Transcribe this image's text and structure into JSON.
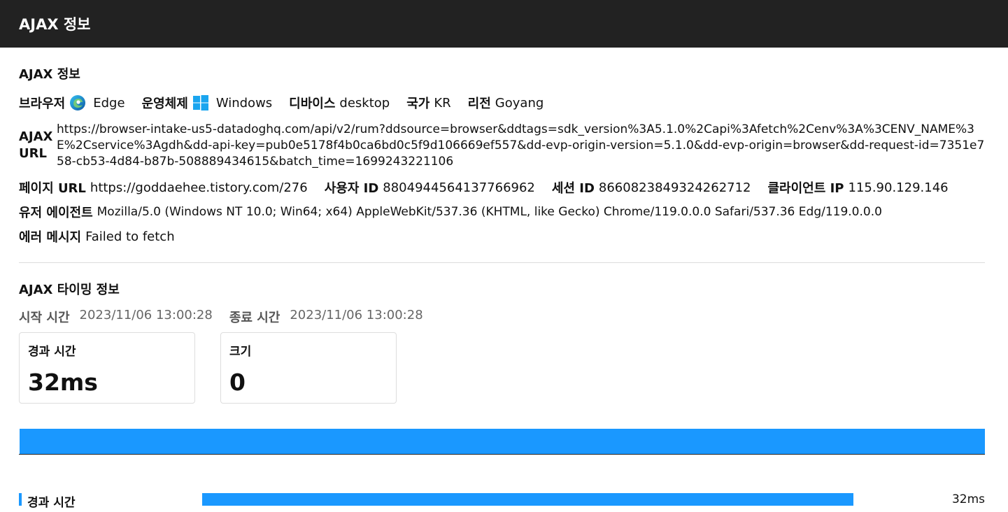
{
  "header": {
    "title": "AJAX 정보"
  },
  "info": {
    "title": "AJAX 정보",
    "browser_label": "브라우저",
    "browser_value": "Edge",
    "os_label": "운영체제",
    "os_value": "Windows",
    "device_label": "디바이스",
    "device_value": "desktop",
    "country_label": "국가",
    "country_value": "KR",
    "region_label": "리전",
    "region_value": "Goyang",
    "url_label": "AJAX URL",
    "url_value": "https://browser-intake-us5-datadoghq.com/api/v2/rum?ddsource=browser&ddtags=sdk_version%3A5.1.0%2Capi%3Afetch%2Cenv%3A%3CENV_NAME%3E%2Cservice%3Agdh&dd-api-key=pub0e5178f4b0ca6bd0c5f9d106669ef557&dd-evp-origin-version=5.1.0&dd-evp-origin=browser&dd-request-id=7351e758-cb53-4d84-b87b-508889434615&batch_time=1699243221106",
    "page_url_label": "페이지 URL",
    "page_url_value": "https://goddaehee.tistory.com/276",
    "user_id_label": "사용자 ID",
    "user_id_value": "8804944564137766962",
    "session_id_label": "세션 ID",
    "session_id_value": "8660823849324262712",
    "client_ip_label": "클라이언트 IP",
    "client_ip_value": "115.90.129.146",
    "user_agent_label": "유저 에이전트",
    "user_agent_value": "Mozilla/5.0 (Windows NT 10.0; Win64; x64) AppleWebKit/537.36 (KHTML, like Gecko) Chrome/119.0.0.0 Safari/537.36 Edg/119.0.0.0",
    "error_label": "에러 메시지",
    "error_value": "Failed to fetch",
    "icons": {
      "browser": "edge-icon",
      "os": "windows-icon"
    }
  },
  "timing": {
    "title": "AJAX 타이밍 정보",
    "start_label": "시작 시간",
    "start_value": "2023/11/06 13:00:28",
    "end_label": "종료 시간",
    "end_value": "2023/11/06 13:00:28",
    "elapsed_card_label": "경과 시간",
    "elapsed_card_value": "32ms",
    "size_card_label": "크기",
    "size_card_value": "0",
    "duration_label": "경과 시간",
    "duration_value": "32ms"
  },
  "colors": {
    "header_bg": "#222222",
    "accent": "#1a98ff"
  }
}
